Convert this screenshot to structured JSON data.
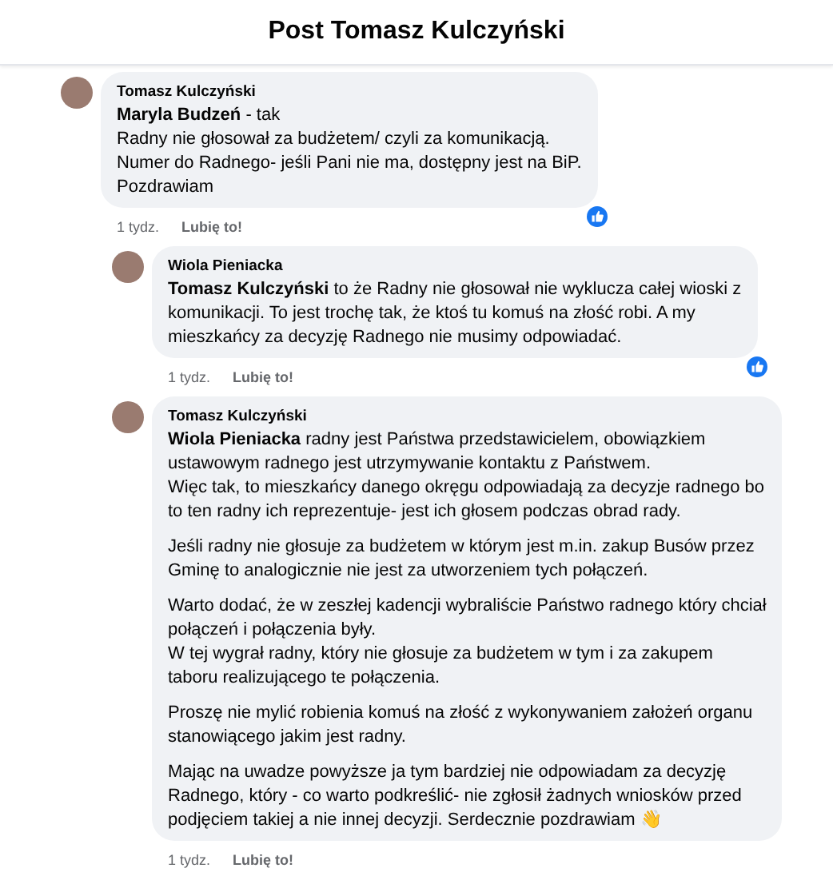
{
  "header": {
    "title": "Post Tomasz Kulczyński"
  },
  "comments": [
    {
      "author": "Tomasz Kulczyński",
      "paragraphs": [
        "**Maryla Budzeń** - tak\nRadny nie głosował za budżetem/ czyli za komunikacją.\nNumer do Radnego- jeśli Pani nie ma, dostępny jest na BiP.\nPozdrawiam"
      ],
      "time": "1 tydz.",
      "like": "Lubię to!",
      "reaction": true,
      "children": [
        {
          "author": "Wiola Pieniacka",
          "paragraphs": [
            "**Tomasz Kulczyński** to że Radny nie głosował nie wyklucza całej wioski z\nkomunikacji. To jest trochę tak, że ktoś tu komuś na złość robi. A my\nmieszkańcy za decyzję Radnego nie musimy odpowiadać."
          ],
          "time": "1 tydz.",
          "like": "Lubię to!",
          "reaction": true
        },
        {
          "author": "Tomasz Kulczyński",
          "paragraphs": [
            "**Wiola Pieniacka** radny jest Państwa przedstawicielem, obowiązkiem\nustawowym radnego jest utrzymywanie kontaktu z Państwem.\nWięc tak, to mieszkańcy danego okręgu odpowiadają za decyzje radnego bo\nto ten radny ich reprezentuje- jest ich głosem podczas obrad rady.",
            "Jeśli radny nie głosuje za budżetem w którym jest m.in. zakup Busów przez\nGminę to analogicznie nie jest za utworzeniem tych połączeń.",
            "Warto dodać, że w zeszłej kadencji wybraliście Państwo radnego który chciał\npołączeń i połączenia były.\nW tej wygrał radny, który nie głosuje za budżetem w tym i za zakupem\ntaboru realizującego te połączenia.",
            "Proszę nie mylić robienia komuś na złość z wykonywaniem założeń organu\nstanowiącego jakim jest radny.",
            "Mając na uwadze powyższe ja tym bardziej nie odpowiadam za decyzję\nRadnego, który - co warto podkreślić- nie zgłosił żadnych wniosków przed\npodjęciem takiej a nie innej decyzji. Serdecznie pozdrawiam 👋"
          ],
          "time": "1 tydz.",
          "like": "Lubię to!"
        }
      ]
    }
  ]
}
